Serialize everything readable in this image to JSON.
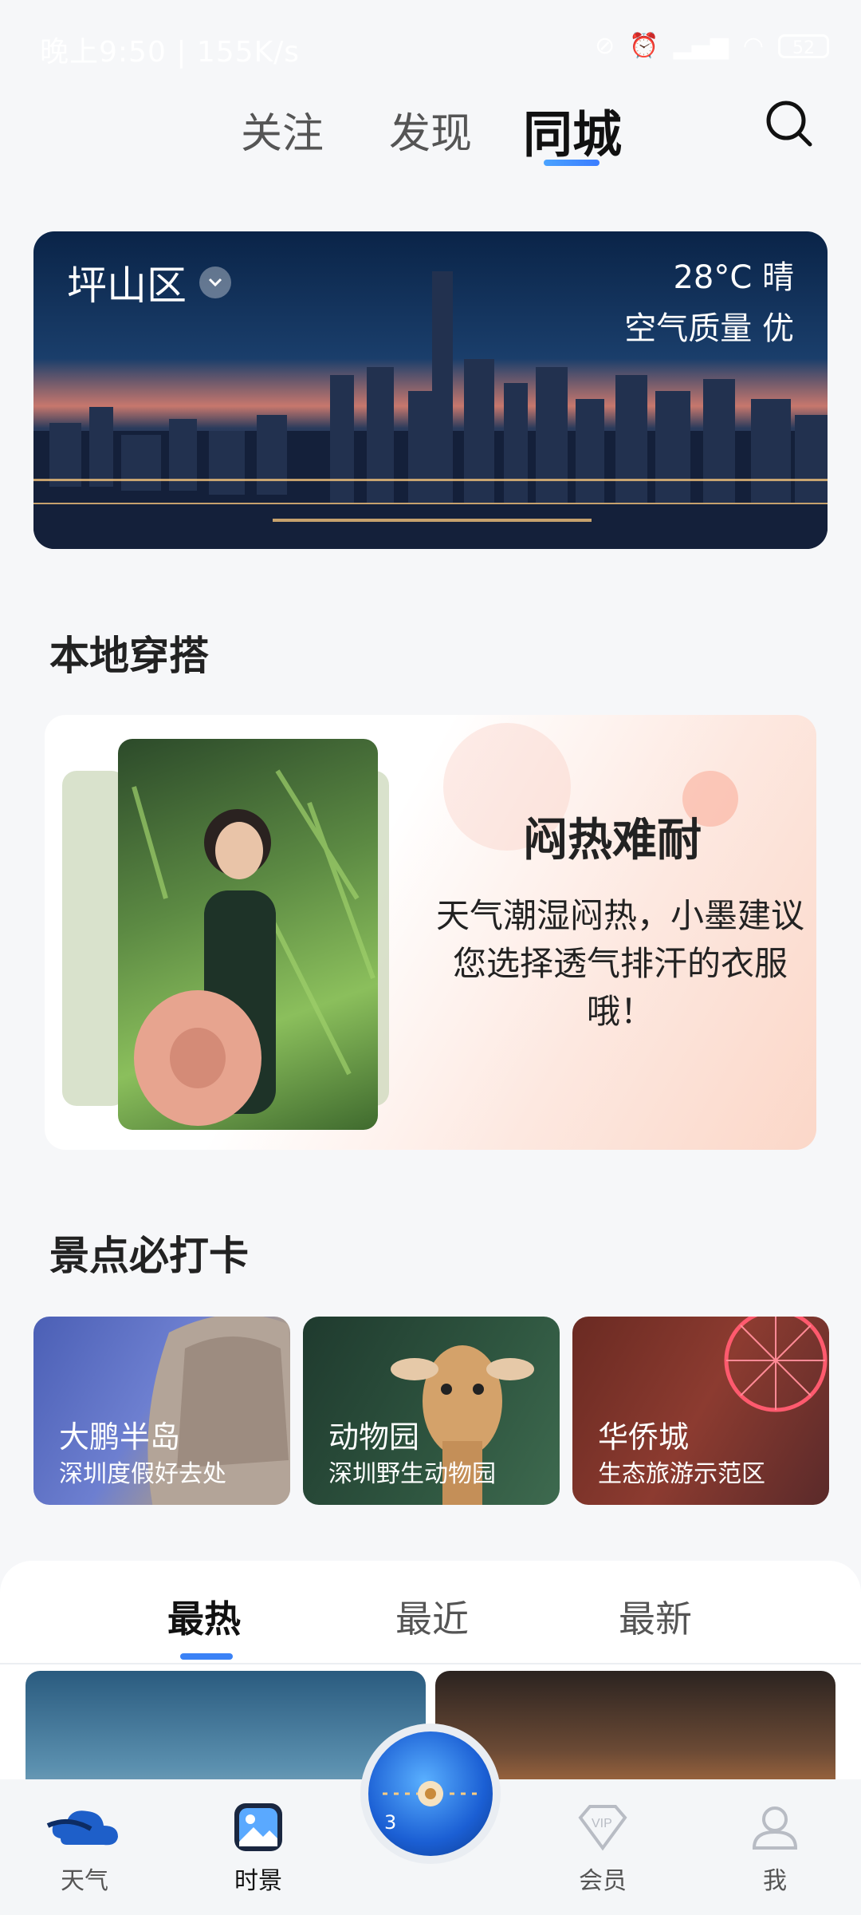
{
  "status_bar": {
    "time_text": "晚上9:50 | 155K/s",
    "battery": "52"
  },
  "top_tabs": [
    {
      "label": "关注"
    },
    {
      "label": "发现"
    },
    {
      "label": "同城"
    }
  ],
  "city_banner": {
    "district": "坪山区",
    "weather": "28°C 晴",
    "air_quality": "空气质量 优"
  },
  "outfit_section": {
    "title": "本地穿搭",
    "headline": "闷热难耐",
    "advice": "天气潮湿闷热，小墨建议您选择透气排汗的衣服哦！"
  },
  "attractions_section": {
    "title": "景点必打卡",
    "items": [
      {
        "name": "大鹏半岛",
        "subtitle": "深圳度假好去处"
      },
      {
        "name": "动物园",
        "subtitle": "深圳野生动物园"
      },
      {
        "name": "华侨城",
        "subtitle": "生态旅游示范区"
      }
    ]
  },
  "feed_tabs": [
    {
      "label": "最热"
    },
    {
      "label": "最近"
    },
    {
      "label": "最新"
    }
  ],
  "bottom_nav": [
    {
      "label": "天气",
      "icon": "weather-cloud-icon"
    },
    {
      "label": "时景",
      "icon": "gallery-icon"
    },
    {
      "label": "会员",
      "icon": "vip-icon"
    },
    {
      "label": "我",
      "icon": "profile-icon"
    }
  ],
  "center_button": {
    "icon": "camera-dial-icon",
    "badge": "3"
  },
  "colors": {
    "accent": "#3b82f6",
    "background": "#f6f7f9"
  }
}
